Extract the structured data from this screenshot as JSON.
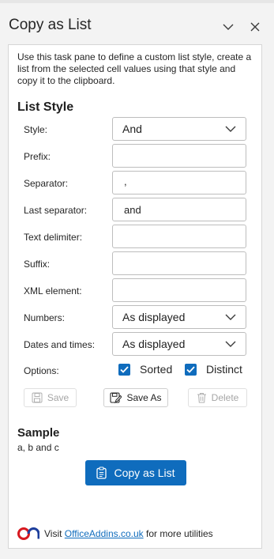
{
  "header": {
    "title": "Copy as List"
  },
  "pane": {
    "description": "Use this task pane to define a custom list style, create a list from the selected cell values using that style and copy it to the clipboard.",
    "list_style_heading": "List Style",
    "fields": {
      "style": {
        "label": "Style:",
        "value": "And"
      },
      "prefix": {
        "label": "Prefix:",
        "value": ""
      },
      "separator": {
        "label": "Separator:",
        "value": ","
      },
      "last_separator": {
        "label": "Last separator:",
        "value": "and"
      },
      "text_delimiter": {
        "label": "Text delimiter:",
        "value": ""
      },
      "suffix": {
        "label": "Suffix:",
        "value": ""
      },
      "xml_element": {
        "label": "XML element:",
        "value": ""
      },
      "numbers": {
        "label": "Numbers:",
        "value": "As displayed"
      },
      "dates": {
        "label": "Dates and times:",
        "value": "As displayed"
      }
    },
    "options": {
      "label": "Options:",
      "sorted": {
        "label": "Sorted",
        "checked": true
      },
      "distinct": {
        "label": "Distinct",
        "checked": true
      }
    },
    "buttons": {
      "save": "Save",
      "save_as": "Save As",
      "delete": "Delete"
    },
    "sample": {
      "heading": "Sample",
      "value": "a, b and c"
    },
    "copy_button": "Copy as List",
    "footer": {
      "prefix": "Visit",
      "link": "OfficeAddins.co.uk",
      "suffix": "for more utilities"
    }
  },
  "colors": {
    "accent": "#0f6cbd",
    "logo_red": "#d71920",
    "logo_blue": "#1d3e9c"
  }
}
